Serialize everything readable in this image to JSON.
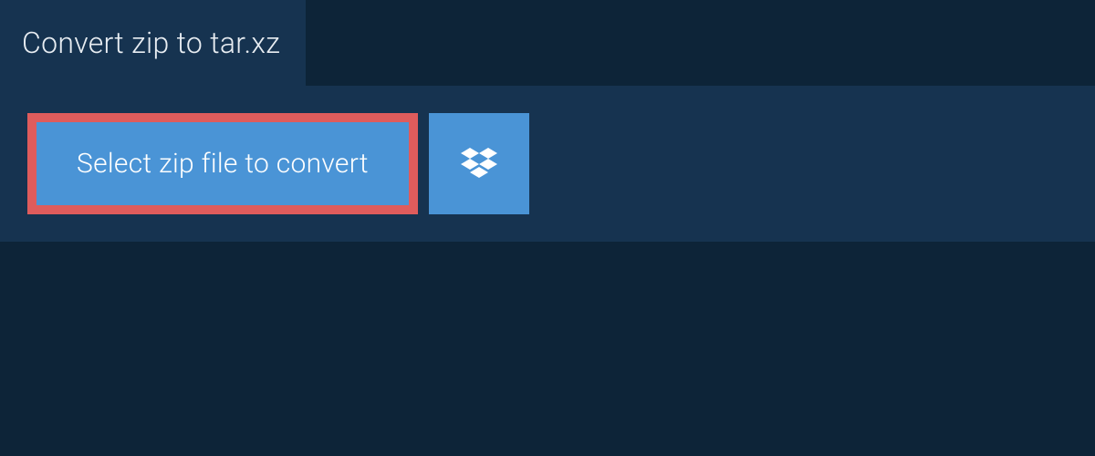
{
  "header": {
    "title": "Convert zip to tar.xz"
  },
  "upload": {
    "select_button_label": "Select zip file to convert"
  },
  "colors": {
    "background_dark": "#0d2438",
    "panel": "#163350",
    "button_blue": "#4a94d6",
    "highlight_red": "#df5c5c",
    "text_light": "#e8edf2"
  }
}
